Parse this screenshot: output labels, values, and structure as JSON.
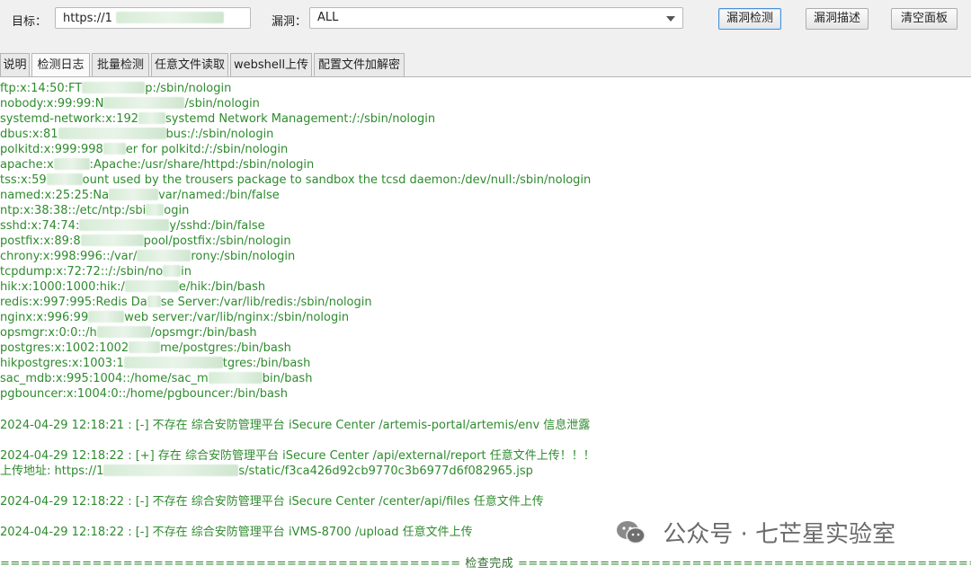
{
  "toolbar": {
    "target_label": "目标：",
    "target_value": "https://1",
    "vuln_label": "漏洞：",
    "vuln_selected": "ALL",
    "btn_detect": "漏洞检测",
    "btn_describe": "漏洞描述",
    "btn_clear": "清空面板"
  },
  "tabs": [
    {
      "label": "说明"
    },
    {
      "label": "检测日志"
    },
    {
      "label": "批量检测"
    },
    {
      "label": "任意文件读取"
    },
    {
      "label": "webshell上传"
    },
    {
      "label": "配置文件加解密"
    }
  ],
  "log": {
    "lines": [
      {
        "pre": "ftp:x:14:50:FT",
        "post": "p:/sbin/nologin"
      },
      {
        "pre": "nobody:x:99:99:N",
        "post": "/sbin/nologin"
      },
      {
        "pre": "systemd-network:x:192",
        "post": "systemd Network Management:/:/sbin/nologin"
      },
      {
        "pre": "dbus:x:81",
        "post": "bus:/:/sbin/nologin"
      },
      {
        "pre": "polkitd:x:999:998",
        "post": "er for polkitd:/:/sbin/nologin"
      },
      {
        "pre": "apache:x",
        "post": ":Apache:/usr/share/httpd:/sbin/nologin"
      },
      {
        "pre": "tss:x:59",
        "post": "ount used by the trousers package to sandbox the tcsd daemon:/dev/null:/sbin/nologin"
      },
      {
        "pre": "named:x:25:25:Na",
        "post": "var/named:/bin/false"
      },
      {
        "pre": "ntp:x:38:38::/etc/ntp:/sbi",
        "post": "ogin"
      },
      {
        "pre": "sshd:x:74:74:",
        "post": "y/sshd:/bin/false"
      },
      {
        "pre": "postfix:x:89:8",
        "post": "pool/postfix:/sbin/nologin"
      },
      {
        "pre": "chrony:x:998:996::/var/",
        "post": "rony:/sbin/nologin"
      },
      {
        "pre": "tcpdump:x:72:72::/:/sbin/no",
        "post": "in"
      },
      {
        "pre": "hik:x:1000:1000:hik:/",
        "post": "e/hik:/bin/bash"
      },
      {
        "pre": "redis:x:997:995:Redis Da",
        "post": "se Server:/var/lib/redis:/sbin/nologin"
      },
      {
        "pre": "nginx:x:996:99",
        "post": "web server:/var/lib/nginx:/sbin/nologin"
      },
      {
        "pre": "opsmgr:x:0:0::/h",
        "post": "/opsmgr:/bin/bash"
      },
      {
        "pre": "postgres:x:1002:1002",
        "post": "me/postgres:/bin/bash"
      },
      {
        "pre": "hikpostgres:x:1003:1",
        "post": "tgres:/bin/bash"
      },
      {
        "pre": "sac_mdb:x:995:1004::/home/sac_m",
        "post": "bin/bash"
      },
      {
        "pre": "pgbouncer:x:1004:0::/home/pgbouncer:/bin/bash",
        "post": ""
      }
    ],
    "events": [
      "2024-04-29 12:18:21 : [-] 不存在 综合安防管理平台 iSecure Center /artemis-portal/artemis/env 信息泄露",
      "2024-04-29 12:18:22 : [+] 存在 综合安防管理平台 iSecure Center /api/external/report 任意文件上传！！！",
      "2024-04-29 12:18:22 : [-] 不存在 综合安防管理平台 iSecure Center /center/api/files 任意文件上传",
      "2024-04-29 12:18:22 : [-] 不存在 综合安防管理平台 iVMS-8700 /upload 任意文件上传"
    ],
    "upload_pre": "上传地址: https://1",
    "upload_post": "s/static/f3ca426d92cb9770c3b6977d6f082965.jsp",
    "separator_left": "=============================================",
    "separator_text": " 检查完成 ",
    "separator_right": "=================================================="
  },
  "watermark": {
    "text": "公众号 · 七芒星实验室"
  }
}
